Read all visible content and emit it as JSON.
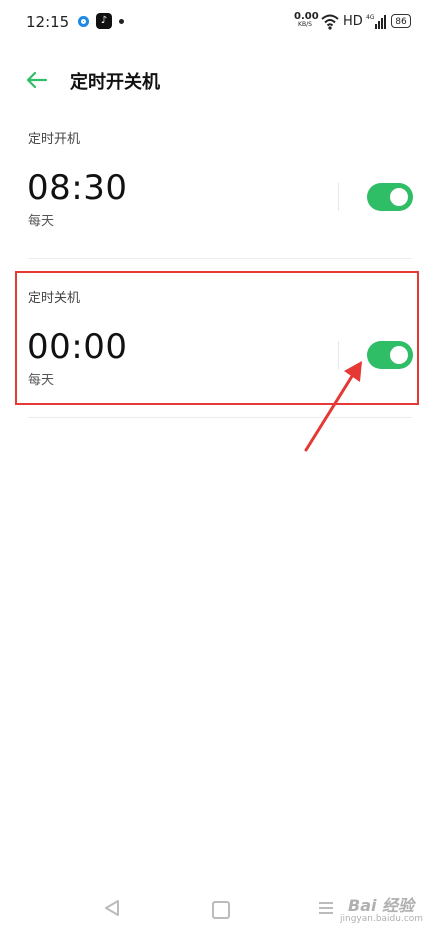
{
  "status_bar": {
    "time": "12:15",
    "net_speed_value": "0.00",
    "net_speed_unit": "KB/S",
    "hd_label": "HD",
    "signal_label": "4G",
    "battery": "86"
  },
  "header": {
    "title": "定时开关机"
  },
  "power_on": {
    "label": "定时开机",
    "time": "08:30",
    "repeat": "每天",
    "enabled": true
  },
  "power_off": {
    "label": "定时关机",
    "time": "00:00",
    "repeat": "每天",
    "enabled": true
  },
  "watermark": {
    "brand": "Bai 经验",
    "url": "jingyan.baidu.com"
  },
  "colors": {
    "accent": "#2fbd66",
    "highlight": "#e53935"
  }
}
